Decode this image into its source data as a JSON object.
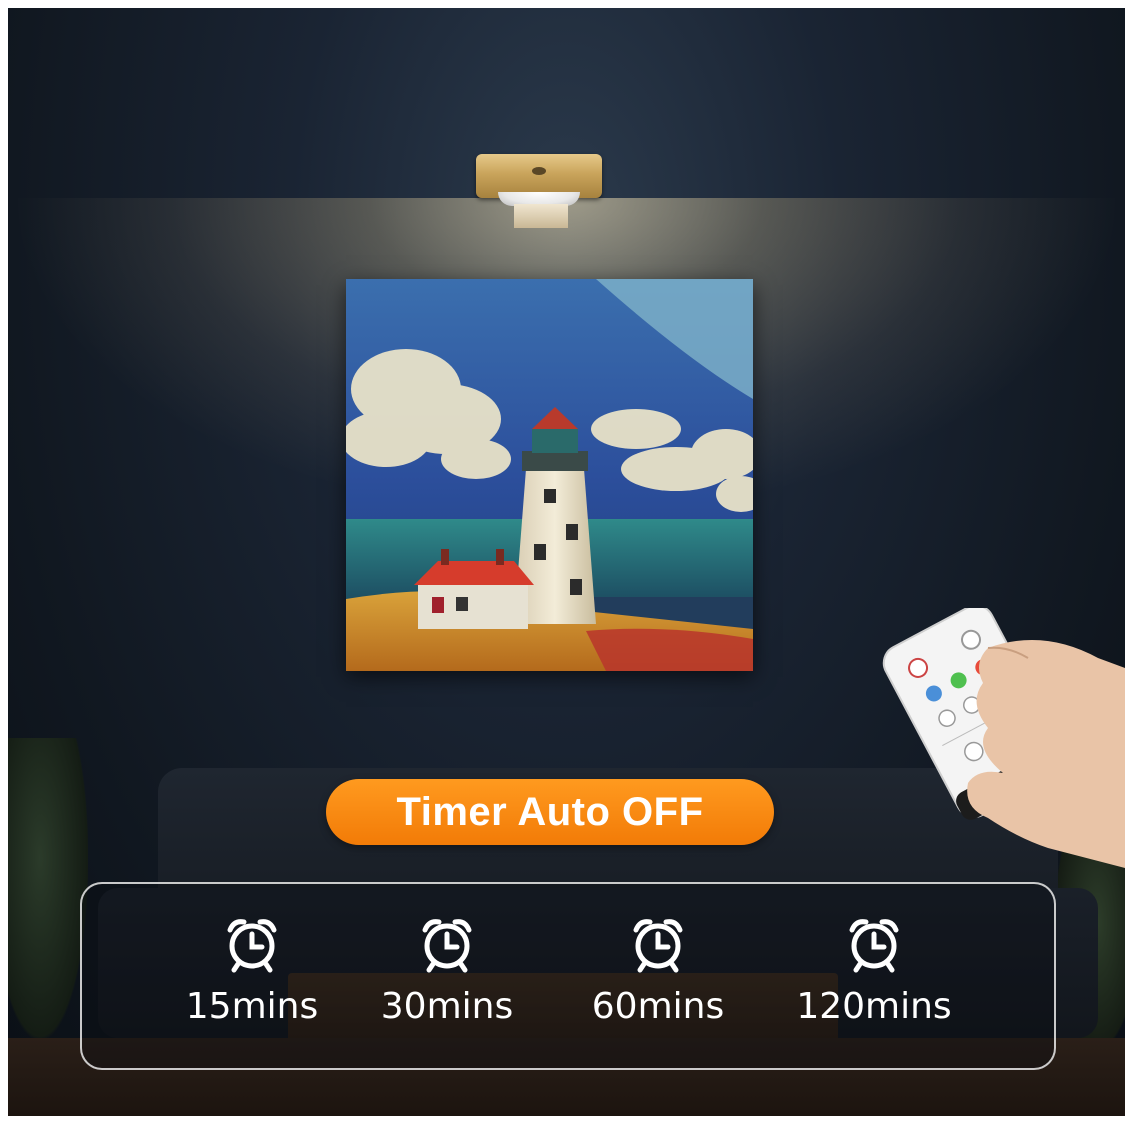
{
  "badge": {
    "label": "Timer Auto OFF",
    "color": "#f5840c"
  },
  "timers": [
    {
      "label": "15mins",
      "icon": "alarm-clock-icon"
    },
    {
      "label": "30mins",
      "icon": "alarm-clock-icon"
    },
    {
      "label": "60mins",
      "icon": "alarm-clock-icon"
    },
    {
      "label": "120mins",
      "icon": "alarm-clock-icon"
    }
  ],
  "colors": {
    "accent": "#f5840c",
    "text": "#ffffff",
    "lamp": "#c9a45b"
  }
}
